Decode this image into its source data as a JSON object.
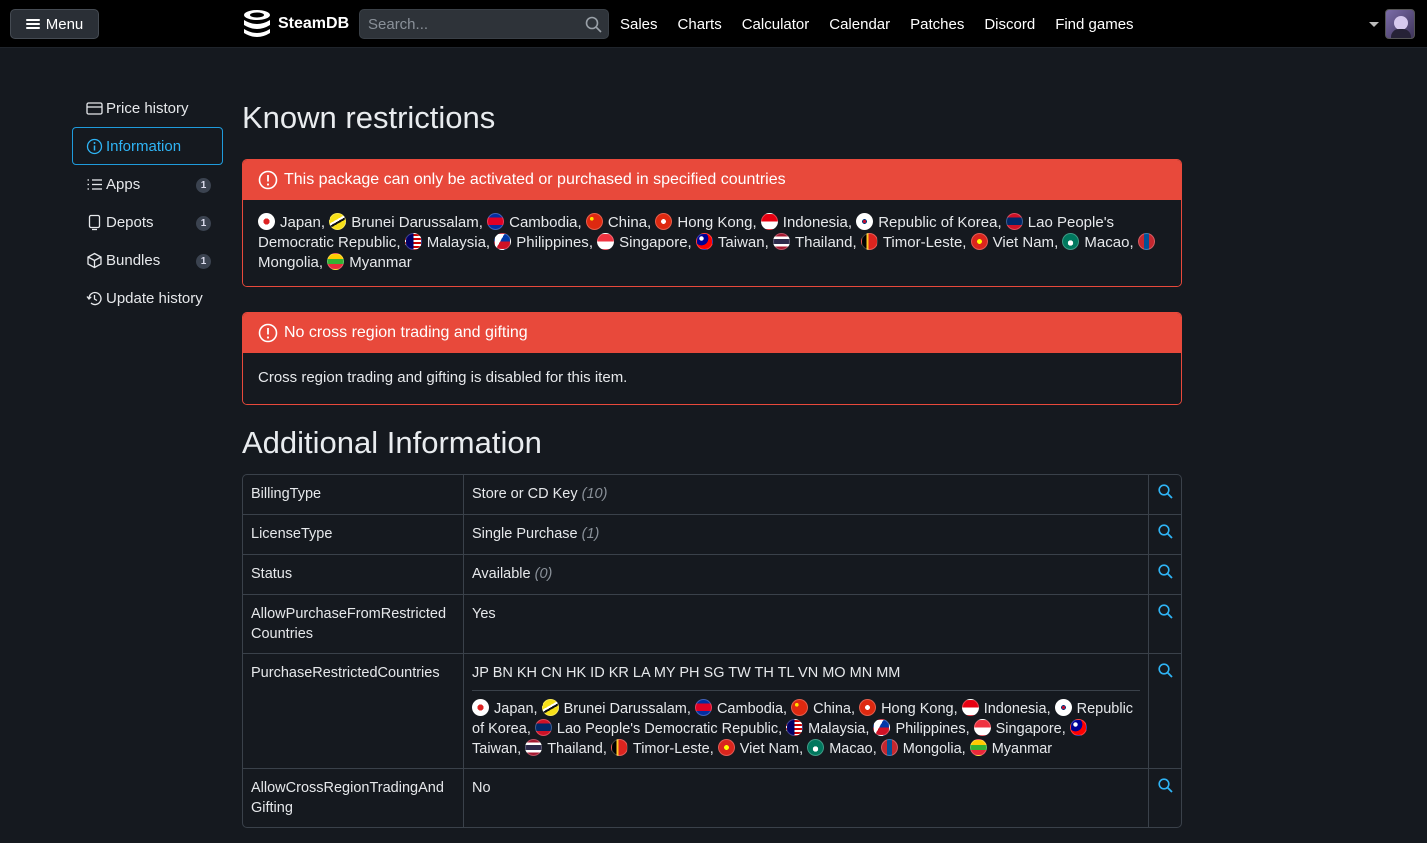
{
  "header": {
    "menu_label": "Menu",
    "logo_text": "SteamDB",
    "search_placeholder": "Search...",
    "nav": [
      "Sales",
      "Charts",
      "Calculator",
      "Calendar",
      "Patches",
      "Discord",
      "Find games"
    ]
  },
  "sidebar": {
    "items": [
      {
        "label": "Price history",
        "icon": "price-tag-icon",
        "badge": ""
      },
      {
        "label": "Information",
        "icon": "info-icon",
        "badge": "",
        "active": true
      },
      {
        "label": "Apps",
        "icon": "list-icon",
        "badge": "1"
      },
      {
        "label": "Depots",
        "icon": "depot-icon",
        "badge": "1"
      },
      {
        "label": "Bundles",
        "icon": "box-icon",
        "badge": "1"
      },
      {
        "label": "Update history",
        "icon": "history-icon",
        "badge": ""
      }
    ]
  },
  "main": {
    "known_title": "Known restrictions",
    "restriction1": {
      "title": "This package can only be activated or purchased in specified countries"
    },
    "restriction2": {
      "title": "No cross region trading and gifting",
      "body": "Cross region trading and gifting is disabled for this item."
    },
    "additional_title": "Additional Information"
  },
  "countries": [
    {
      "name": "Japan",
      "code": "JP"
    },
    {
      "name": "Brunei Darussalam",
      "code": "BN"
    },
    {
      "name": "Cambodia",
      "code": "KH"
    },
    {
      "name": "China",
      "code": "CN"
    },
    {
      "name": "Hong Kong",
      "code": "HK"
    },
    {
      "name": "Indonesia",
      "code": "ID"
    },
    {
      "name": "Republic of Korea",
      "code": "KR"
    },
    {
      "name": "Lao People's Democratic Republic",
      "code": "LA"
    },
    {
      "name": "Malaysia",
      "code": "MY"
    },
    {
      "name": "Philippines",
      "code": "PH"
    },
    {
      "name": "Singapore",
      "code": "SG"
    },
    {
      "name": "Taiwan",
      "code": "TW"
    },
    {
      "name": "Thailand",
      "code": "TH"
    },
    {
      "name": "Timor-Leste",
      "code": "TL"
    },
    {
      "name": "Viet Nam",
      "code": "VN"
    },
    {
      "name": "Macao",
      "code": "MO"
    },
    {
      "name": "Mongolia",
      "code": "MN"
    },
    {
      "name": "Myanmar",
      "code": "MM"
    }
  ],
  "info_rows": [
    {
      "key": "BillingType",
      "value": "Store or CD Key",
      "extra": "(10)"
    },
    {
      "key": "LicenseType",
      "value": "Single Purchase",
      "extra": "(1)"
    },
    {
      "key": "Status",
      "value": "Available",
      "extra": "(0)"
    },
    {
      "key": "AllowPurchaseFromRestrictedCountries",
      "value": "Yes",
      "extra": ""
    },
    {
      "key": "PurchaseRestrictedCountries",
      "value": "JP BN KH CN HK ID KR LA MY PH SG TW TH TL VN MO MN MM",
      "extra": "",
      "flags": true
    },
    {
      "key": "AllowCrossRegionTradingAndGifting",
      "value": "No",
      "extra": ""
    }
  ],
  "colors": {
    "accent": "#1f9bdc",
    "alert": "#e8493b",
    "background": "#15191f"
  }
}
